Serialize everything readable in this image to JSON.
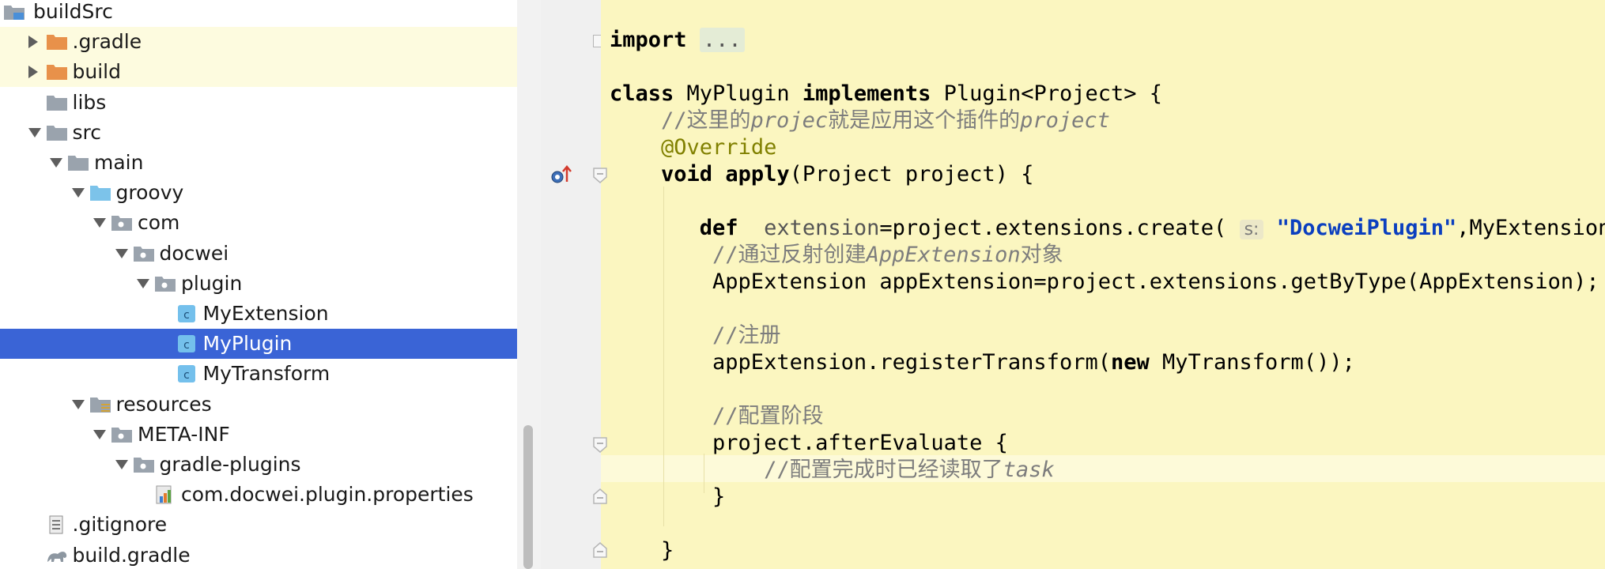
{
  "project_tree": {
    "items": [
      {
        "label": "buildSrc",
        "icon": "module-folder-icon",
        "depth": 0,
        "state": "none"
      },
      {
        "label": ".gradle",
        "icon": "excluded-folder-icon",
        "depth": 1,
        "state": "collapsed"
      },
      {
        "label": "build",
        "icon": "excluded-folder-icon",
        "depth": 1,
        "state": "collapsed"
      },
      {
        "label": "libs",
        "icon": "folder-icon",
        "depth": 1,
        "state": "none"
      },
      {
        "label": "src",
        "icon": "folder-icon",
        "depth": 1,
        "state": "expanded"
      },
      {
        "label": "main",
        "icon": "folder-icon",
        "depth": 2,
        "state": "expanded"
      },
      {
        "label": "groovy",
        "icon": "source-folder-icon",
        "depth": 3,
        "state": "expanded"
      },
      {
        "label": "com",
        "icon": "package-icon",
        "depth": 4,
        "state": "expanded"
      },
      {
        "label": "docwei",
        "icon": "package-icon",
        "depth": 5,
        "state": "expanded"
      },
      {
        "label": "plugin",
        "icon": "package-icon",
        "depth": 6,
        "state": "expanded"
      },
      {
        "label": "MyExtension",
        "icon": "groovy-class-icon",
        "depth": 7,
        "state": "none"
      },
      {
        "label": "MyPlugin",
        "icon": "groovy-class-icon",
        "depth": 7,
        "state": "none"
      },
      {
        "label": "MyTransform",
        "icon": "groovy-class-icon",
        "depth": 7,
        "state": "none"
      },
      {
        "label": "resources",
        "icon": "resources-folder-icon",
        "depth": 3,
        "state": "expanded"
      },
      {
        "label": "META-INF",
        "icon": "package-icon",
        "depth": 4,
        "state": "expanded"
      },
      {
        "label": "gradle-plugins",
        "icon": "package-icon",
        "depth": 5,
        "state": "expanded"
      },
      {
        "label": "com.docwei.plugin.properties",
        "icon": "properties-file-icon",
        "depth": 6,
        "state": "none"
      },
      {
        "label": ".gitignore",
        "icon": "text-file-icon",
        "depth": 1,
        "state": "none"
      },
      {
        "label": "build.gradle",
        "icon": "gradle-file-icon",
        "depth": 1,
        "state": "none"
      }
    ],
    "selected_index": 11
  },
  "editor": {
    "lines": [
      {
        "segments": [
          {
            "t": "import",
            "c": "kw2"
          },
          {
            "t": " "
          },
          {
            "t": "...",
            "c": "folded"
          }
        ]
      },
      {
        "segments": []
      },
      {
        "segments": [
          {
            "t": "class",
            "c": "kw2"
          },
          {
            "t": " MyPlugin "
          },
          {
            "t": "implements",
            "c": "kw2"
          },
          {
            "t": " Plugin<Project> {"
          }
        ]
      },
      {
        "segments": [
          {
            "t": "    "
          },
          {
            "t": "//这里的",
            "c": "cmt"
          },
          {
            "t": "projec",
            "c": "cmt-i"
          },
          {
            "t": "就是应用这个插件的",
            "c": "cmt"
          },
          {
            "t": "project",
            "c": "cmt-i"
          }
        ]
      },
      {
        "segments": [
          {
            "t": "    "
          },
          {
            "t": "@Override",
            "c": "anno"
          }
        ]
      },
      {
        "segments": [
          {
            "t": "    "
          },
          {
            "t": "void",
            "c": "kw2"
          },
          {
            "t": " "
          },
          {
            "t": "apply",
            "c": "fn"
          },
          {
            "t": "(Project project) {"
          }
        ]
      },
      {
        "segments": []
      },
      {
        "segments": [
          {
            "t": "       "
          },
          {
            "t": "def",
            "c": "kw2"
          },
          {
            "t": "  "
          },
          {
            "t": "extension",
            "c": "dim"
          },
          {
            "t": "=project.extensions.create( "
          },
          {
            "t": "s:",
            "c": "hint"
          },
          {
            "t": " "
          },
          {
            "t": "\"DocweiPlugin\"",
            "c": "str"
          },
          {
            "t": ",MyExtension)"
          }
        ]
      },
      {
        "segments": [
          {
            "t": "        "
          },
          {
            "t": "//通过反射创建",
            "c": "cmt"
          },
          {
            "t": "AppExtension",
            "c": "cmt-i"
          },
          {
            "t": "对象",
            "c": "cmt"
          }
        ]
      },
      {
        "segments": [
          {
            "t": "        AppExtension appExtension=project.extensions.getByType(AppExtension);"
          }
        ]
      },
      {
        "segments": []
      },
      {
        "segments": [
          {
            "t": "        "
          },
          {
            "t": "//注册",
            "c": "cmt"
          }
        ]
      },
      {
        "segments": [
          {
            "t": "        appExtension.registerTransform("
          },
          {
            "t": "new",
            "c": "kw2"
          },
          {
            "t": " MyTransform());"
          }
        ]
      },
      {
        "segments": []
      },
      {
        "segments": [
          {
            "t": "        "
          },
          {
            "t": "//配置阶段",
            "c": "cmt"
          }
        ]
      },
      {
        "segments": [
          {
            "t": "        project.afterEvaluate {"
          }
        ]
      },
      {
        "segments": [
          {
            "t": "            "
          },
          {
            "t": "//配置完成时已经读取了",
            "c": "cmt"
          },
          {
            "t": "task",
            "c": "cmt-i"
          }
        ]
      },
      {
        "segments": [
          {
            "t": "        }"
          }
        ]
      },
      {
        "segments": []
      },
      {
        "segments": [
          {
            "t": "    }"
          }
        ]
      }
    ]
  },
  "colors": {
    "tree_selection": "#3a64d6",
    "editor_background": "#fbf6c0",
    "keyword": "#000000",
    "comment": "#7d7d7d",
    "annotation": "#808000",
    "string": "#0b3fbf"
  }
}
